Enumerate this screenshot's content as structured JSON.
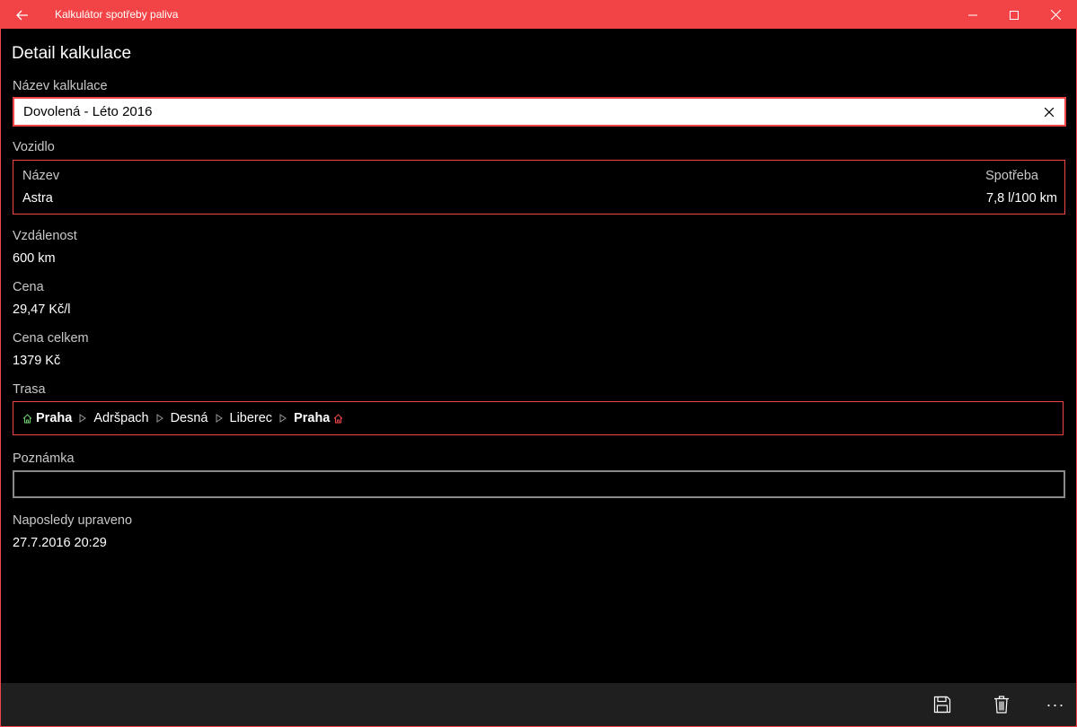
{
  "window": {
    "title": "Kalkulátor spotřeby paliva"
  },
  "page": {
    "title": "Detail kalkulace"
  },
  "name_field": {
    "label": "Název kalkulace",
    "value": "Dovolená - Léto 2016"
  },
  "vehicle": {
    "label": "Vozidlo",
    "name_header": "Název",
    "name_value": "Astra",
    "consumption_header": "Spotřeba",
    "consumption_value": "7,8 l/100 km"
  },
  "distance": {
    "label": "Vzdálenost",
    "value": "600 km"
  },
  "price": {
    "label": "Cena",
    "value": "29,47 Kč/l"
  },
  "total_price": {
    "label": "Cena celkem",
    "value": "1379 Kč"
  },
  "route": {
    "label": "Trasa",
    "stops": [
      "Praha",
      "Adršpach",
      "Desná",
      "Liberec",
      "Praha"
    ],
    "start_icon_color": "#6fcf6f",
    "end_icon_color": "#f24446"
  },
  "note": {
    "label": "Poznámka",
    "value": ""
  },
  "last_modified": {
    "label": "Naposledy upraveno",
    "value": "27.7.2016 20:29"
  },
  "colors": {
    "accent": "#f24446",
    "background": "#000000",
    "appbar": "#1f1f1f"
  },
  "appbar": {
    "more_label": "···"
  }
}
